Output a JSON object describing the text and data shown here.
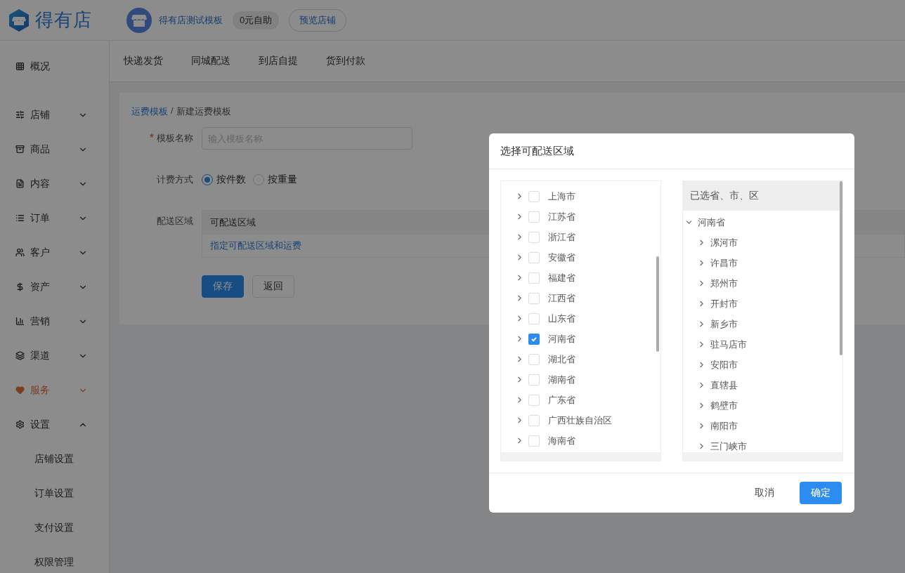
{
  "brand": {
    "name": "得有店"
  },
  "shop": {
    "name": "得有店测试模板",
    "plan": "0元自助",
    "preview_button": "预览店铺"
  },
  "sidebar": {
    "items": [
      {
        "label": "概况",
        "selected": false
      },
      {
        "label": "店铺",
        "selected": false,
        "expanded": false
      },
      {
        "label": "商品",
        "selected": false,
        "expanded": false
      },
      {
        "label": "内容",
        "selected": false,
        "expanded": false
      },
      {
        "label": "订单",
        "selected": false,
        "expanded": false
      },
      {
        "label": "客户",
        "selected": false,
        "expanded": false
      },
      {
        "label": "资产",
        "selected": false,
        "expanded": false
      },
      {
        "label": "营销",
        "selected": false,
        "expanded": false
      },
      {
        "label": "渠道",
        "selected": false,
        "expanded": false
      },
      {
        "label": "服务",
        "selected": true,
        "expanded": false
      },
      {
        "label": "设置",
        "selected": false,
        "expanded": true,
        "children": [
          {
            "label": "店铺设置"
          },
          {
            "label": "订单设置"
          },
          {
            "label": "支付设置"
          },
          {
            "label": "权限管理"
          }
        ]
      }
    ]
  },
  "tabs": [
    {
      "label": "快递发货"
    },
    {
      "label": "同城配送"
    },
    {
      "label": "到店自提"
    },
    {
      "label": "货到付款"
    }
  ],
  "breadcrumb": {
    "items": [
      {
        "label": "运费模板",
        "link": true
      },
      {
        "label": "新建运费模板",
        "link": false
      }
    ],
    "separator": "/"
  },
  "form": {
    "name_field": {
      "label": "模板名称",
      "required_mark": "*",
      "placeholder": "输入模板名称"
    },
    "billing": {
      "label": "计费方式",
      "options": [
        {
          "label": "按件数",
          "selected": true
        },
        {
          "label": "按重量",
          "selected": false
        }
      ]
    },
    "area": {
      "label": "配送区域",
      "column": "可配送区域",
      "link": "指定可配送区域和运费"
    },
    "buttons": [
      {
        "label": "保存",
        "primary": true
      },
      {
        "label": "返回",
        "primary": false
      }
    ]
  },
  "dialog": {
    "title": "选择可配送区域",
    "provinces": [
      {
        "label": "上海市",
        "checked": false
      },
      {
        "label": "江苏省",
        "checked": false
      },
      {
        "label": "浙江省",
        "checked": false
      },
      {
        "label": "安徽省",
        "checked": false
      },
      {
        "label": "福建省",
        "checked": false
      },
      {
        "label": "江西省",
        "checked": false
      },
      {
        "label": "山东省",
        "checked": false
      },
      {
        "label": "河南省",
        "checked": true
      },
      {
        "label": "湖北省",
        "checked": false
      },
      {
        "label": "湖南省",
        "checked": false
      },
      {
        "label": "广东省",
        "checked": false
      },
      {
        "label": "广西壮族自治区",
        "checked": false
      },
      {
        "label": "海南省",
        "checked": false
      }
    ],
    "selected_header": "已选省、市、区",
    "selected_tree": [
      {
        "label": "河南省",
        "expanded": true,
        "children": [
          {
            "label": "漯河市",
            "expanded": false
          },
          {
            "label": "许昌市",
            "expanded": false
          },
          {
            "label": "郑州市",
            "expanded": false
          },
          {
            "label": "开封市",
            "expanded": false
          },
          {
            "label": "新乡市",
            "expanded": false
          },
          {
            "label": "驻马店市",
            "expanded": false
          },
          {
            "label": "安阳市",
            "expanded": false
          },
          {
            "label": "直辖县",
            "expanded": false
          },
          {
            "label": "鹤壁市",
            "expanded": false
          },
          {
            "label": "南阳市",
            "expanded": false
          },
          {
            "label": "三门峡市",
            "expanded": false
          }
        ]
      }
    ],
    "buttons": [
      {
        "label": "取消",
        "primary": false
      },
      {
        "label": "确定",
        "primary": true
      }
    ]
  }
}
